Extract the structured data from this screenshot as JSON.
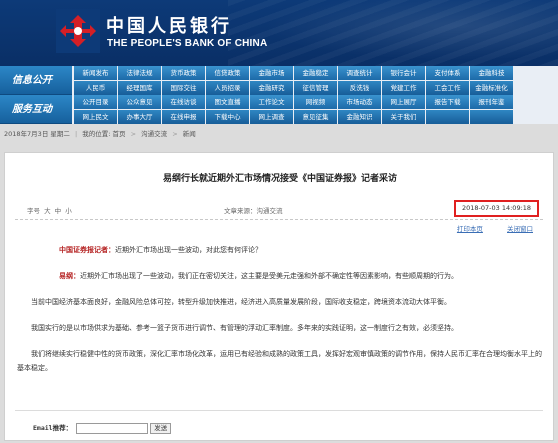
{
  "header": {
    "logo_cn": "中国人民银行",
    "logo_en": "THE PEOPLE'S BANK OF CHINA",
    "colors": {
      "banner": "#0d3a78",
      "nav": "#1d6aa8",
      "highlight": "#e02020"
    }
  },
  "nav": {
    "group1": {
      "label": "信息公开",
      "rows": [
        [
          "新闻发布",
          "法律法规",
          "货币政策",
          "信贷政策",
          "金融市场",
          "金融稳定",
          "调查统计",
          "银行会计",
          "支付体系",
          "金融科技"
        ],
        [
          "人民币",
          "经理国库",
          "国际交往",
          "人员招录",
          "金融研究",
          "征信管理",
          "反洗钱",
          "党建工作",
          "工会工作",
          "金融标准化"
        ]
      ]
    },
    "group2": {
      "label": "服务互动",
      "rows": [
        [
          "公开目录",
          "公众意见",
          "在线访谈",
          "图文直播",
          "工作论文",
          "网视频",
          "市场动态",
          "网上展厅",
          "报告下载",
          "报刊年鉴"
        ],
        [
          "网上民文",
          "办事大厅",
          "在线申报",
          "下载中心",
          "网上调查",
          "意见征集",
          "金融知识",
          "关于我们",
          "",
          ""
        ]
      ]
    }
  },
  "breadcrumb": {
    "date": "2018年7月3日 星期二",
    "path": [
      "我的位置: 首页",
      "沟通交流",
      "新闻"
    ]
  },
  "article": {
    "title": "易纲行长就近期外汇市场情况接受《中国证券报》记者采访",
    "font_size_label": "字号",
    "font_sizes": [
      "大",
      "中",
      "小"
    ],
    "source": "文章来源：沟通交流",
    "date": "2018-07-03 14:09:18",
    "print_label": "打印本页",
    "close_label": "关闭窗口",
    "q_speaker": "中国证券报记者：",
    "q_text": "近期外汇市场出现一些波动，对此您有何评论？",
    "a_speaker": "易纲：",
    "a_text": "近期外汇市场出现了一些波动，我们正在密切关注，这主要是受美元走强和外部不确定性等因素影响，有些顺周期的行为。",
    "p1": "当前中国经济基本面良好，金融风险总体可控，转型升级加快推进，经济进入高质量发展阶段，国际收支稳定，跨境资本流动大体平衡。",
    "p2": "我国实行的是以市场供求为基础、参考一篮子货币进行调节、有管理的浮动汇率制度。多年来的实践证明，这一制度行之有效，必须坚持。",
    "p3": "我们将继续实行稳健中性的货币政策，深化汇率市场化改革，运用已有经验和成熟的政策工具，发挥好宏观审慎政策的调节作用，保持人民币汇率在合理均衡水平上的基本稳定。"
  },
  "email": {
    "label": "Email推荐：",
    "button": "发送"
  }
}
